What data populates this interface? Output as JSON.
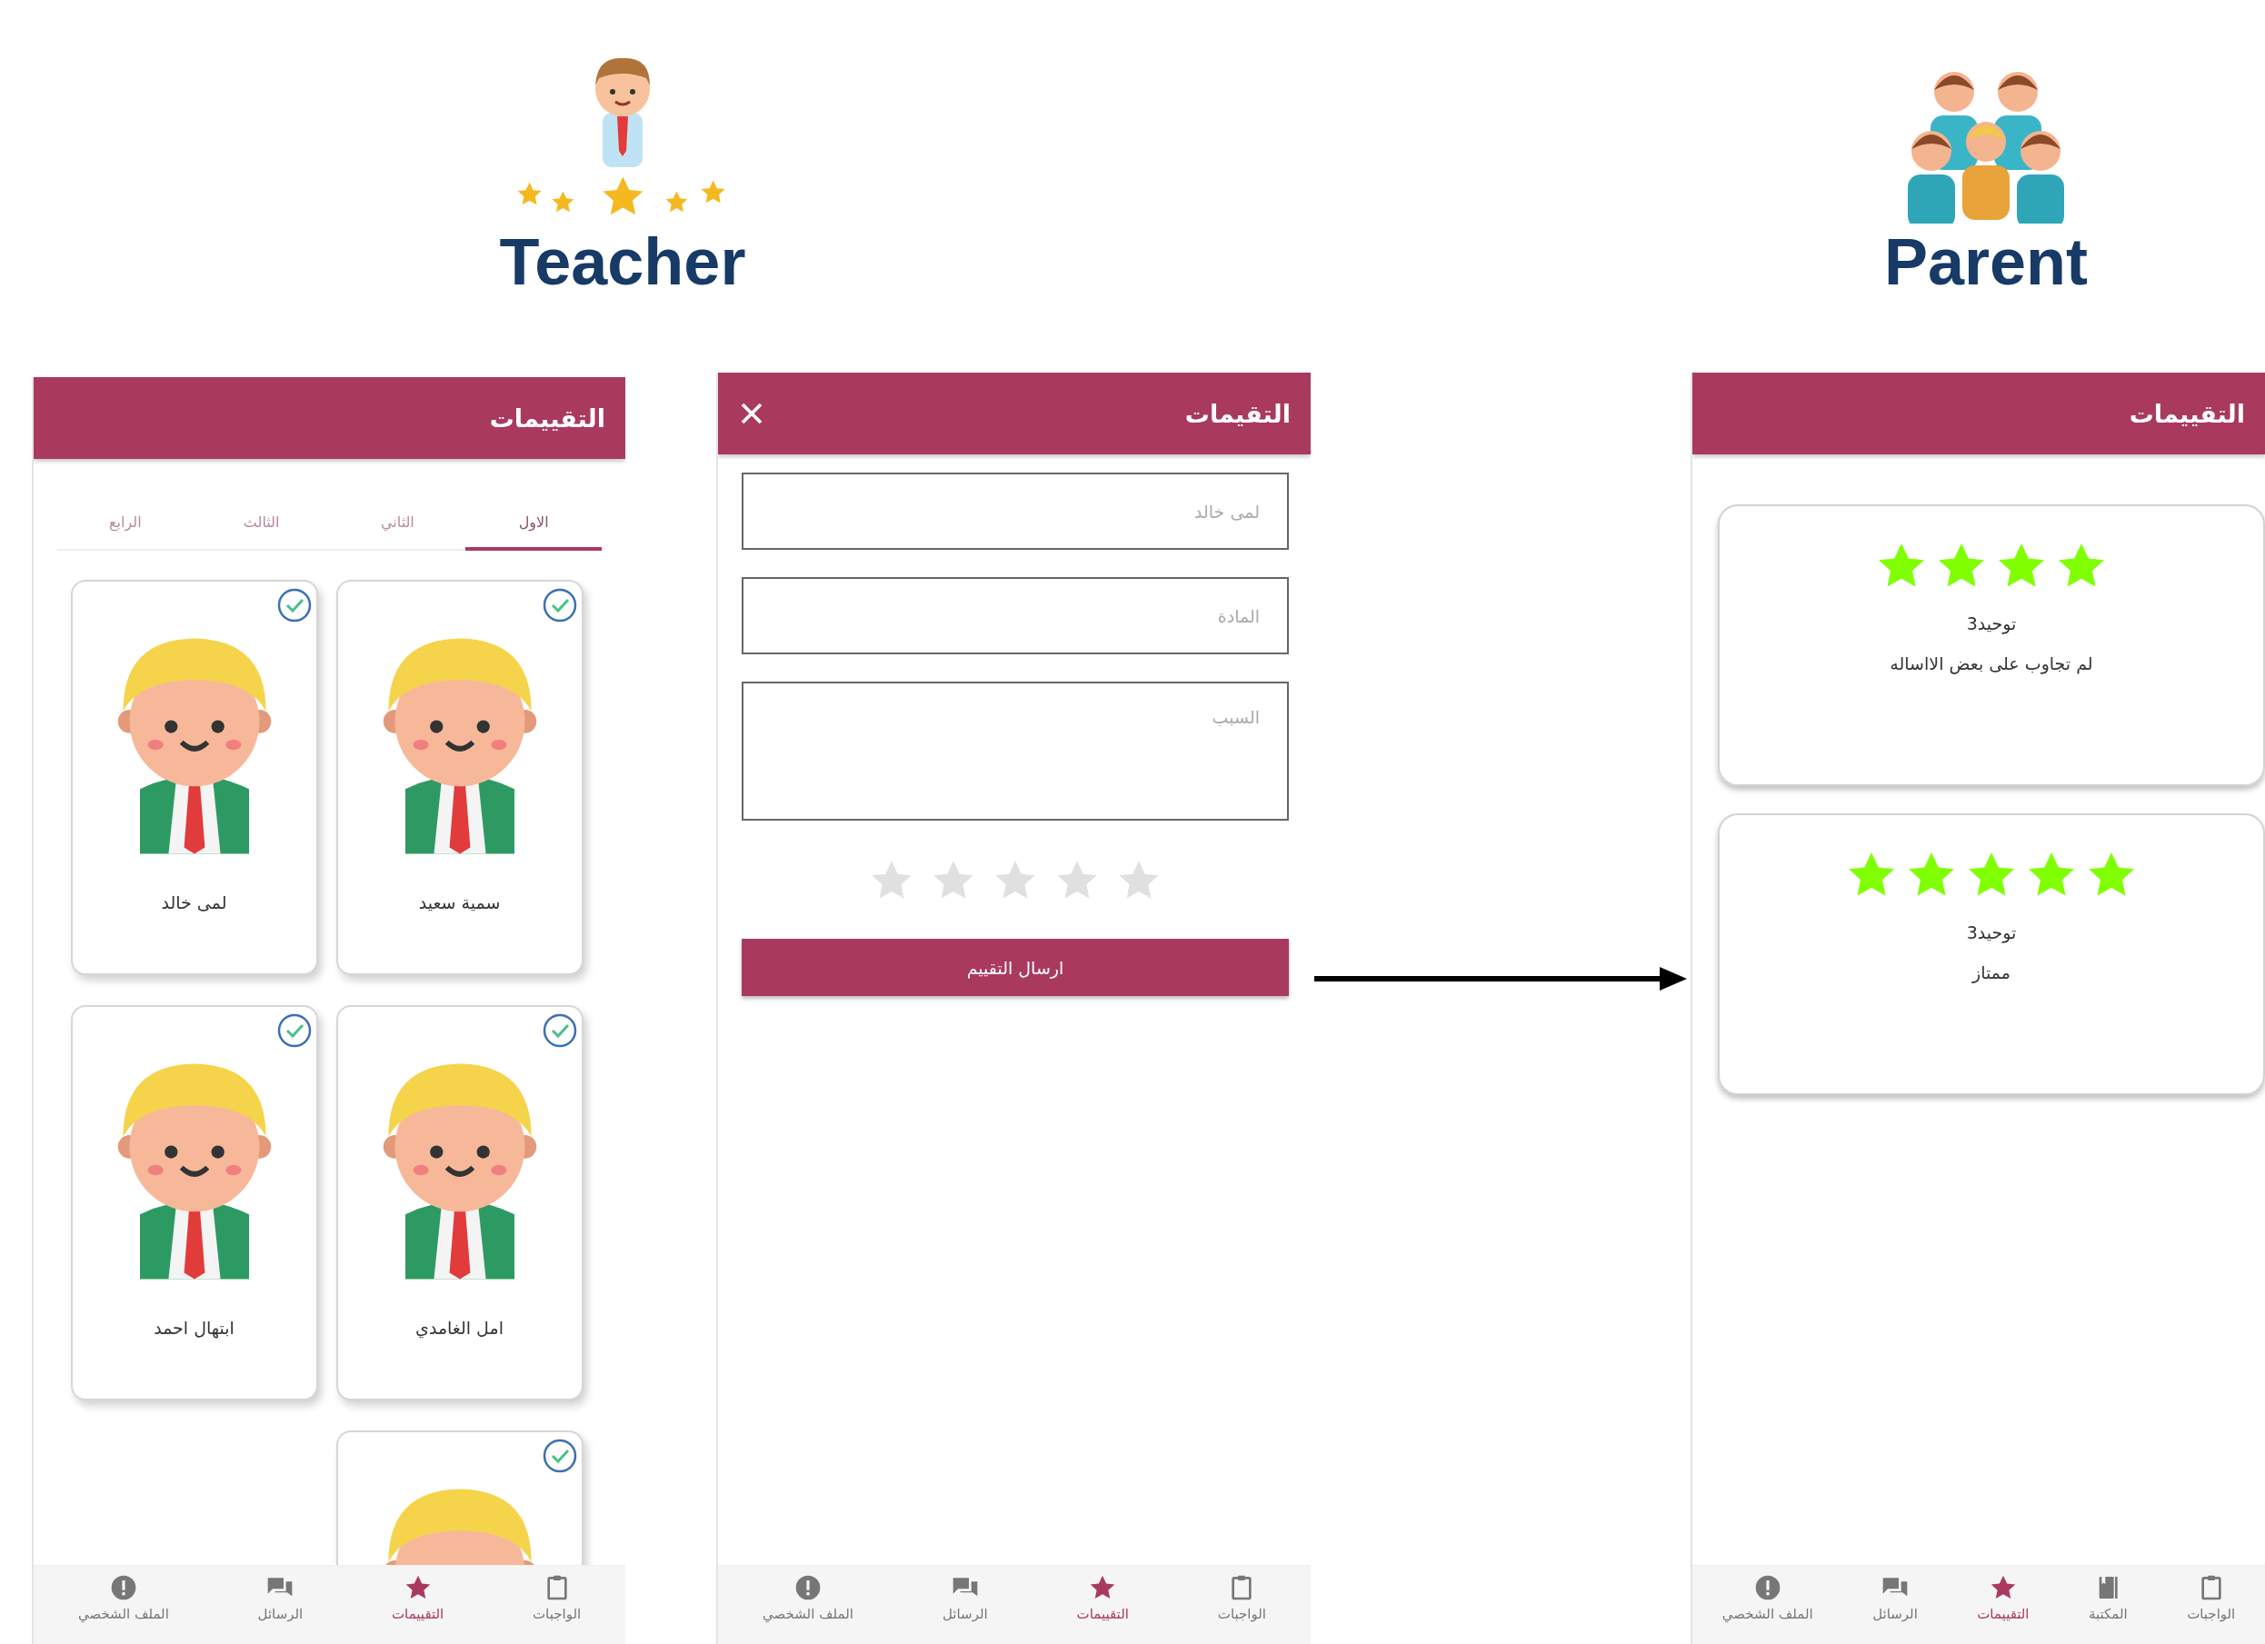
{
  "teacher_heading": {
    "label": "Teacher"
  },
  "parent_heading": {
    "label": "Parent"
  },
  "teacher_list_screen": {
    "title": "التقييمات",
    "tabs": [
      {
        "label": "الاول",
        "selected": true
      },
      {
        "label": "الثاني",
        "selected": false
      },
      {
        "label": "الثالث",
        "selected": false
      },
      {
        "label": "الرابع",
        "selected": false
      }
    ],
    "students": [
      {
        "name": "سمية سعيد",
        "checked": true
      },
      {
        "name": "لمى خالد",
        "checked": true
      },
      {
        "name": "امل الغامدي",
        "checked": true
      },
      {
        "name": "ابتهال احمد",
        "checked": true
      },
      {
        "checked": true
      }
    ],
    "bottom_nav": [
      {
        "kind": "clipboard",
        "label": "الواجبات",
        "selected": false
      },
      {
        "kind": "star",
        "label": "التقييمات",
        "selected": true
      },
      {
        "kind": "chat",
        "label": "الرسائل",
        "selected": false
      },
      {
        "kind": "alert",
        "label": "الملف الشخصي",
        "selected": false
      }
    ]
  },
  "rating_form_screen": {
    "title": "التقيمات",
    "fields": [
      {
        "kind": "input",
        "placeholder": "لمى خالد"
      },
      {
        "kind": "input",
        "placeholder": "المادة"
      },
      {
        "kind": "textarea",
        "placeholder": "السبب"
      }
    ],
    "rating": {
      "stars": 0
    },
    "submit_button": "ارسال التقييم",
    "bottom_nav": [
      {
        "kind": "clipboard",
        "label": "الواجبات",
        "selected": false
      },
      {
        "kind": "star",
        "label": "التقييمات",
        "selected": true
      },
      {
        "kind": "chat",
        "label": "الرسائل",
        "selected": false
      },
      {
        "kind": "alert",
        "label": "الملف الشخصي",
        "selected": false
      }
    ]
  },
  "parent_ratings_screen": {
    "title": "التقييمات",
    "ratings": [
      {
        "stars": 4,
        "subject": "توحيد3",
        "comment": "لم تجاوب على بعض الااساله"
      },
      {
        "stars": 5,
        "subject": "توحيد3",
        "comment": "ممتاز"
      }
    ],
    "bottom_nav": [
      {
        "kind": "clipboard",
        "label": "الواجبات",
        "selected": false
      },
      {
        "kind": "book",
        "label": "المكتبة",
        "selected": false
      },
      {
        "kind": "star",
        "label": "التقييمات",
        "selected": true
      },
      {
        "kind": "chat",
        "label": "الرسائل",
        "selected": false
      },
      {
        "kind": "alert",
        "label": "الملف الشخصي",
        "selected": false
      }
    ]
  }
}
